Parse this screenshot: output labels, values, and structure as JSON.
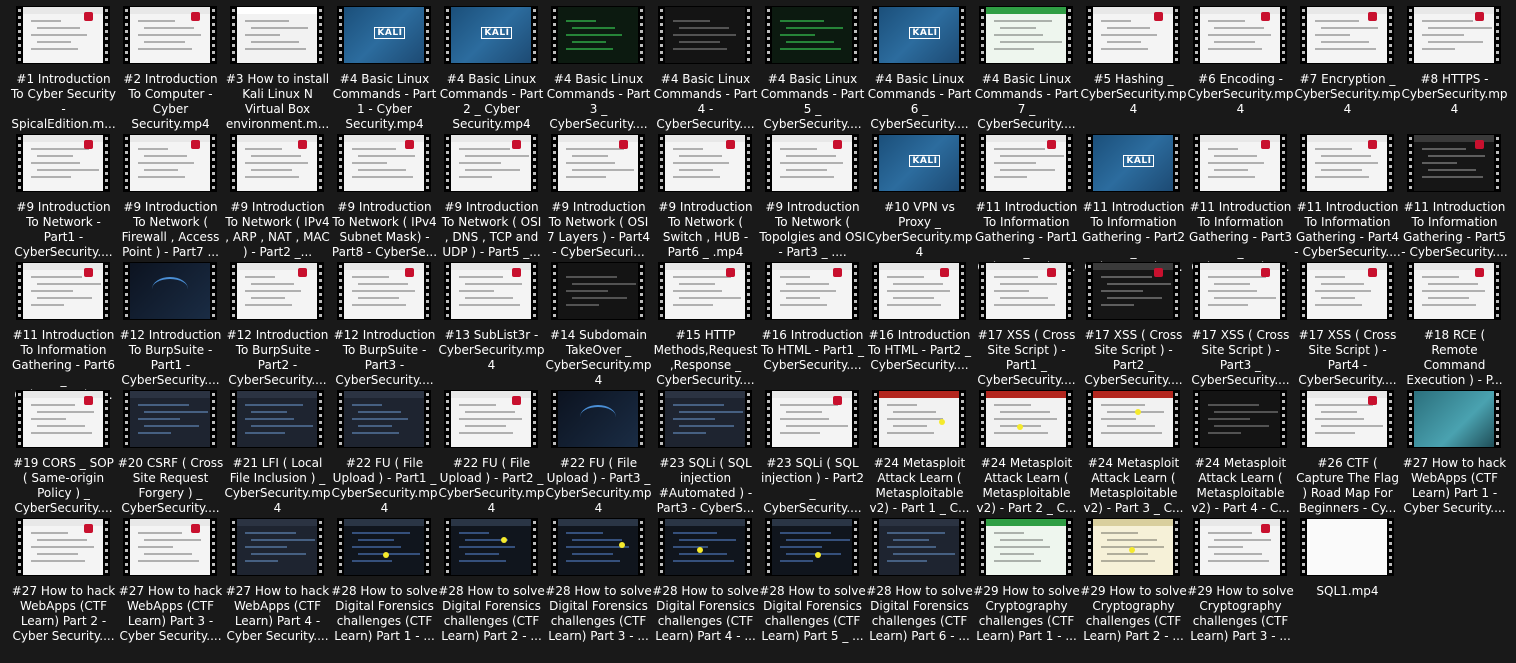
{
  "files": [
    {
      "label": "#1 Introduction To Cyber Security - SpicalEdition.m...",
      "theme": "doc"
    },
    {
      "label": "#2 Introduction To Computer - Cyber Security.mp4",
      "theme": "doc"
    },
    {
      "label": "#3 How to install Kali Linux N Virtual Box environment.m...",
      "theme": "window"
    },
    {
      "label": "#4 Basic Linux Commands - Part 1 - Cyber Security.mp4",
      "theme": "kali"
    },
    {
      "label": "#4 Basic Linux Commands - Part 2 _ Cyber Security.mp4",
      "theme": "kali"
    },
    {
      "label": "#4 Basic Linux Commands - Part 3 _ CyberSecurity....",
      "theme": "terminal"
    },
    {
      "label": "#4 Basic Linux Commands - Part 4 - CyberSecurity....",
      "theme": "term-dark"
    },
    {
      "label": "#4 Basic Linux Commands - Part 5 _ CyberSecurity....",
      "theme": "terminal"
    },
    {
      "label": "#4 Basic Linux Commands - Part 6 _ CyberSecurity....",
      "theme": "kali"
    },
    {
      "label": "#4 Basic Linux Commands - Part 7 _ CyberSecurity....",
      "theme": "green"
    },
    {
      "label": "#5 Hashing _ CyberSecurity.mp4",
      "theme": "doc"
    },
    {
      "label": "#6 Encoding - CyberSecurity.mp4",
      "theme": "doc"
    },
    {
      "label": "#7 Encryption _ CyberSecurity.mp4",
      "theme": "doc"
    },
    {
      "label": "#8 HTTPS - CyberSecurity.mp4",
      "theme": "doc"
    },
    {
      "label": "#9 Introduction To Network - Part1 - CyberSecurity....",
      "theme": "doc"
    },
    {
      "label": "#9 Introduction To Network ( Firewall , Access Point ) - Part7 ...",
      "theme": "doc"
    },
    {
      "label": "#9 Introduction To Network ( IPv4 , ARP , NAT , MAC ) - Part2 _...",
      "theme": "doc"
    },
    {
      "label": "#9 Introduction To Network ( IPv4 Subnet Mask) - Part8 - CyberSe...",
      "theme": "doc"
    },
    {
      "label": "#9 Introduction To Network ( OSI , DNS , TCP and UDP ) - Part5 _...",
      "theme": "doc"
    },
    {
      "label": "#9 Introduction To Network ( OSI 7 Layers ) - Part4 - CyberSecuri...",
      "theme": "doc"
    },
    {
      "label": "#9 Introduction To Network ( Switch , HUB - Part6 _ .mp4",
      "theme": "doc"
    },
    {
      "label": "#9 Introduction To Network ( Topolgies and OSI - Part3 _ ....",
      "theme": "doc"
    },
    {
      "label": "#10 VPN vs Proxy _ CyberSecurity.mp4",
      "theme": "kali"
    },
    {
      "label": "#11 Introduction To Information Gathering - Part1 _ CyberSecurity....",
      "theme": "doc"
    },
    {
      "label": "#11 Introduction To Information Gathering - Part2 _ CyberSecurity....",
      "theme": "kali"
    },
    {
      "label": "#11 Introduction To Information Gathering - Part3 _ CyberSecurity....",
      "theme": "doc"
    },
    {
      "label": "#11 Introduction To Information Gathering - Part4 - CyberSecurity....",
      "theme": "doc"
    },
    {
      "label": "#11 Introduction To Information Gathering - Part5 - CyberSecurity....",
      "theme": "dark-web"
    },
    {
      "label": "#11 Introduction To Information Gathering - Part6 _ CyberSecurity....",
      "theme": "doc"
    },
    {
      "label": "#12 Introduction To BurpSuite - Part1 - CyberSecurity....",
      "theme": "kali-dark"
    },
    {
      "label": "#12 Introduction To BurpSuite - Part2 - CyberSecurity....",
      "theme": "doc"
    },
    {
      "label": "#12 Introduction To BurpSuite - Part3 - CyberSecurity....",
      "theme": "doc"
    },
    {
      "label": "#13 SubList3r - CyberSecurity.mp4",
      "theme": "doc"
    },
    {
      "label": "#14 Subdomain TakeOver _ CyberSecurity.mp4",
      "theme": "term-dark"
    },
    {
      "label": "#15 HTTP Methods,Request ,Response _ CyberSecurity....",
      "theme": "doc"
    },
    {
      "label": "#16 Introduction To HTML - Part1 _ CyberSecurity....",
      "theme": "doc"
    },
    {
      "label": "#16 Introduction To HTML - Part2 _ CyberSecurity....",
      "theme": "doc"
    },
    {
      "label": "#17 XSS ( Cross Site Script ) - Part1 _ CyberSecurity....",
      "theme": "doc"
    },
    {
      "label": "#17 XSS ( Cross Site Script ) - Part2 _ CyberSecurity....",
      "theme": "dark-web"
    },
    {
      "label": "#17 XSS ( Cross Site Script ) - Part3 _ CyberSecurity....",
      "theme": "doc"
    },
    {
      "label": "#17 XSS ( Cross Site Script ) - Part4 - CyberSecurity....",
      "theme": "doc"
    },
    {
      "label": "#18 RCE ( Remote Command Execution ) - P...",
      "theme": "doc"
    },
    {
      "label": "#19 CORS _ SOP ( Same-origin Policy ) _ CyberSecurity....",
      "theme": "doc"
    },
    {
      "label": "#20 CSRF ( Cross Site Request Forgery ) _ CyberSecurity....",
      "theme": "ide"
    },
    {
      "label": "#21 LFI ( Local File Inclusion ) _ CyberSecurity.mp4",
      "theme": "ide"
    },
    {
      "label": "#22 FU ( File Upload ) - Part1 _ CyberSecurity.mp4",
      "theme": "ide"
    },
    {
      "label": "#22 FU ( File Upload ) - Part2 _ CyberSecurity.mp4",
      "theme": "doc"
    },
    {
      "label": "#22 FU ( File Upload ) - Part3 _ CyberSecurity.mp4",
      "theme": "kali-dark"
    },
    {
      "label": "#23 SQLi ( SQL injection #Automated ) - Part3 - CyberS...",
      "theme": "ide"
    },
    {
      "label": "#23 SQLi ( SQL injection ) - Part2 _ CyberSecurity....",
      "theme": "doc"
    },
    {
      "label": "#24 Metasploit Attack Learn ( Metasploitable v2) - Part 1 _ C...",
      "theme": "red"
    },
    {
      "label": "#24 Metasploit Attack Learn ( Metasploitable v2) - Part 2 _ C...",
      "theme": "red"
    },
    {
      "label": "#24 Metasploit Attack Learn ( Metasploitable v2) - Part 3 _ C...",
      "theme": "red"
    },
    {
      "label": "#24 Metasploit Attack Learn ( Metasploitable v2) - Part 4 - C...",
      "theme": "term-dark"
    },
    {
      "label": "#26 CTF ( Capture The Flag ) Road Map For Beginners - Cy...",
      "theme": "doc"
    },
    {
      "label": "#27 How to hack WebApps (CTF Learn) Part 1 - Cyber Security....",
      "theme": "teal"
    },
    {
      "label": "#27 How to hack WebApps (CTF Learn) Part 2 - Cyber Security....",
      "theme": "doc"
    },
    {
      "label": "#27 How to hack WebApps (CTF Learn) Part 3 - Cyber Security....",
      "theme": "doc"
    },
    {
      "label": "#27 How to hack WebApps (CTF Learn) Part 4 - Cyber Security....",
      "theme": "ide"
    },
    {
      "label": "#28 How to solve Digital Forensics challenges (CTF Learn) Part 1 - ...",
      "theme": "dark-ui"
    },
    {
      "label": "#28 How to solve Digital Forensics challenges (CTF Learn) Part 2 - ...",
      "theme": "dark-ui"
    },
    {
      "label": "#28 How to solve Digital Forensics challenges (CTF Learn) Part 3 - ...",
      "theme": "dark-ui"
    },
    {
      "label": "#28 How to solve Digital Forensics challenges (CTF Learn) Part 4 - ...",
      "theme": "dark-ui"
    },
    {
      "label": "#28 How to solve Digital Forensics challenges (CTF Learn) Part 5 _ ...",
      "theme": "dark-ui"
    },
    {
      "label": "#28 How to solve Digital Forensics challenges (CTF Learn) Part 6 - ...",
      "theme": "ide"
    },
    {
      "label": "#29 How to solve Cryptography challenges (CTF Learn) Part 1 - ...",
      "theme": "green"
    },
    {
      "label": "#29 How to solve Cryptography challenges (CTF Learn) Part 2 - ...",
      "theme": "cream"
    },
    {
      "label": "#29 How to solve Cryptography challenges (CTF Learn) Part 3 - ...",
      "theme": "doc"
    },
    {
      "label": "SQL1.mp4",
      "theme": "blank"
    }
  ]
}
